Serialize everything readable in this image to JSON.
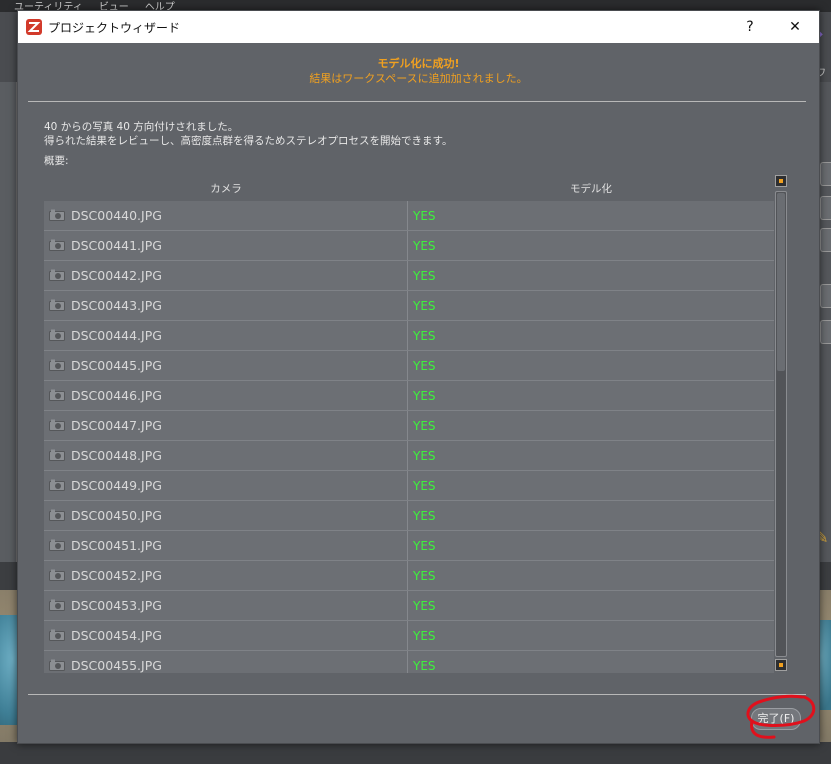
{
  "background": {
    "menu_items": [
      "ユーティリティ",
      "ビュー",
      "ヘルプ"
    ],
    "side_text": "ワニ"
  },
  "dialog": {
    "title": "プロジェクトウィザード",
    "help_label": "?",
    "close_label": "✕",
    "success_title": "モデル化に成功!",
    "success_subtitle": "結果はワークスペースに追加加されました。",
    "info_line1": "40 からの写真 40 方向付けされました。",
    "info_line2": "得られた結果をレビューし、高密度点群を得るためステレオプロセスを開始できます。",
    "summary_label": "概要:",
    "table": {
      "columns": [
        "カメラ",
        "モデル化"
      ],
      "rows": [
        {
          "camera": "DSC00440.JPG",
          "status": "YES"
        },
        {
          "camera": "DSC00441.JPG",
          "status": "YES"
        },
        {
          "camera": "DSC00442.JPG",
          "status": "YES"
        },
        {
          "camera": "DSC00443.JPG",
          "status": "YES"
        },
        {
          "camera": "DSC00444.JPG",
          "status": "YES"
        },
        {
          "camera": "DSC00445.JPG",
          "status": "YES"
        },
        {
          "camera": "DSC00446.JPG",
          "status": "YES"
        },
        {
          "camera": "DSC00447.JPG",
          "status": "YES"
        },
        {
          "camera": "DSC00448.JPG",
          "status": "YES"
        },
        {
          "camera": "DSC00449.JPG",
          "status": "YES"
        },
        {
          "camera": "DSC00450.JPG",
          "status": "YES"
        },
        {
          "camera": "DSC00451.JPG",
          "status": "YES"
        },
        {
          "camera": "DSC00452.JPG",
          "status": "YES"
        },
        {
          "camera": "DSC00453.JPG",
          "status": "YES"
        },
        {
          "camera": "DSC00454.JPG",
          "status": "YES"
        },
        {
          "camera": "DSC00455.JPG",
          "status": "YES"
        }
      ]
    },
    "finish_label": "完了(F)"
  },
  "colors": {
    "accent_orange": "#f0a020",
    "status_green": "#3df23d",
    "annotation_red": "#e0101c"
  },
  "icons": {
    "app": "app-logo-icon",
    "camera": "camera-icon"
  }
}
